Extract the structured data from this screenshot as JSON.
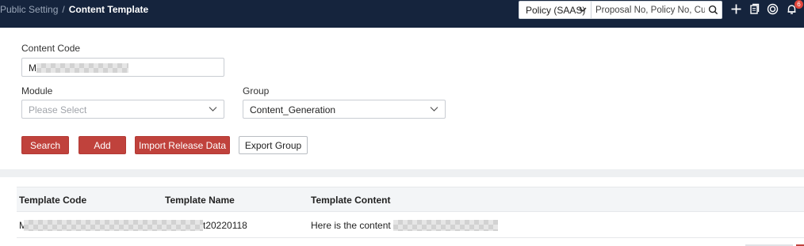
{
  "header": {
    "breadcrumb_parent": "Public Setting",
    "breadcrumb_separator": "/",
    "breadcrumb_current": "Content Template",
    "product_select": "Policy (SAAS)",
    "search_placeholder": "Proposal No, Policy No, Cust",
    "notification_count": "6",
    "icons": [
      "plus-icon",
      "document-icon",
      "circle-icon",
      "bell-icon"
    ]
  },
  "form": {
    "content_code": {
      "label": "Content Code",
      "value": "M"
    },
    "module": {
      "label": "Module",
      "placeholder": "Please Select"
    },
    "group": {
      "label": "Group",
      "value": "Content_Generation"
    }
  },
  "actions": {
    "search": "Search",
    "add": "Add",
    "import": "Import Release Data",
    "export": "Export Group"
  },
  "table": {
    "columns": [
      "Template Code",
      "Template Name",
      "Template Content"
    ],
    "rows": [
      {
        "code": "M",
        "name_suffix": "t20220118",
        "content_prefix": "Here is the content of"
      }
    ]
  },
  "colors": {
    "header_bg": "#15243d",
    "primary": "#c0423c"
  }
}
